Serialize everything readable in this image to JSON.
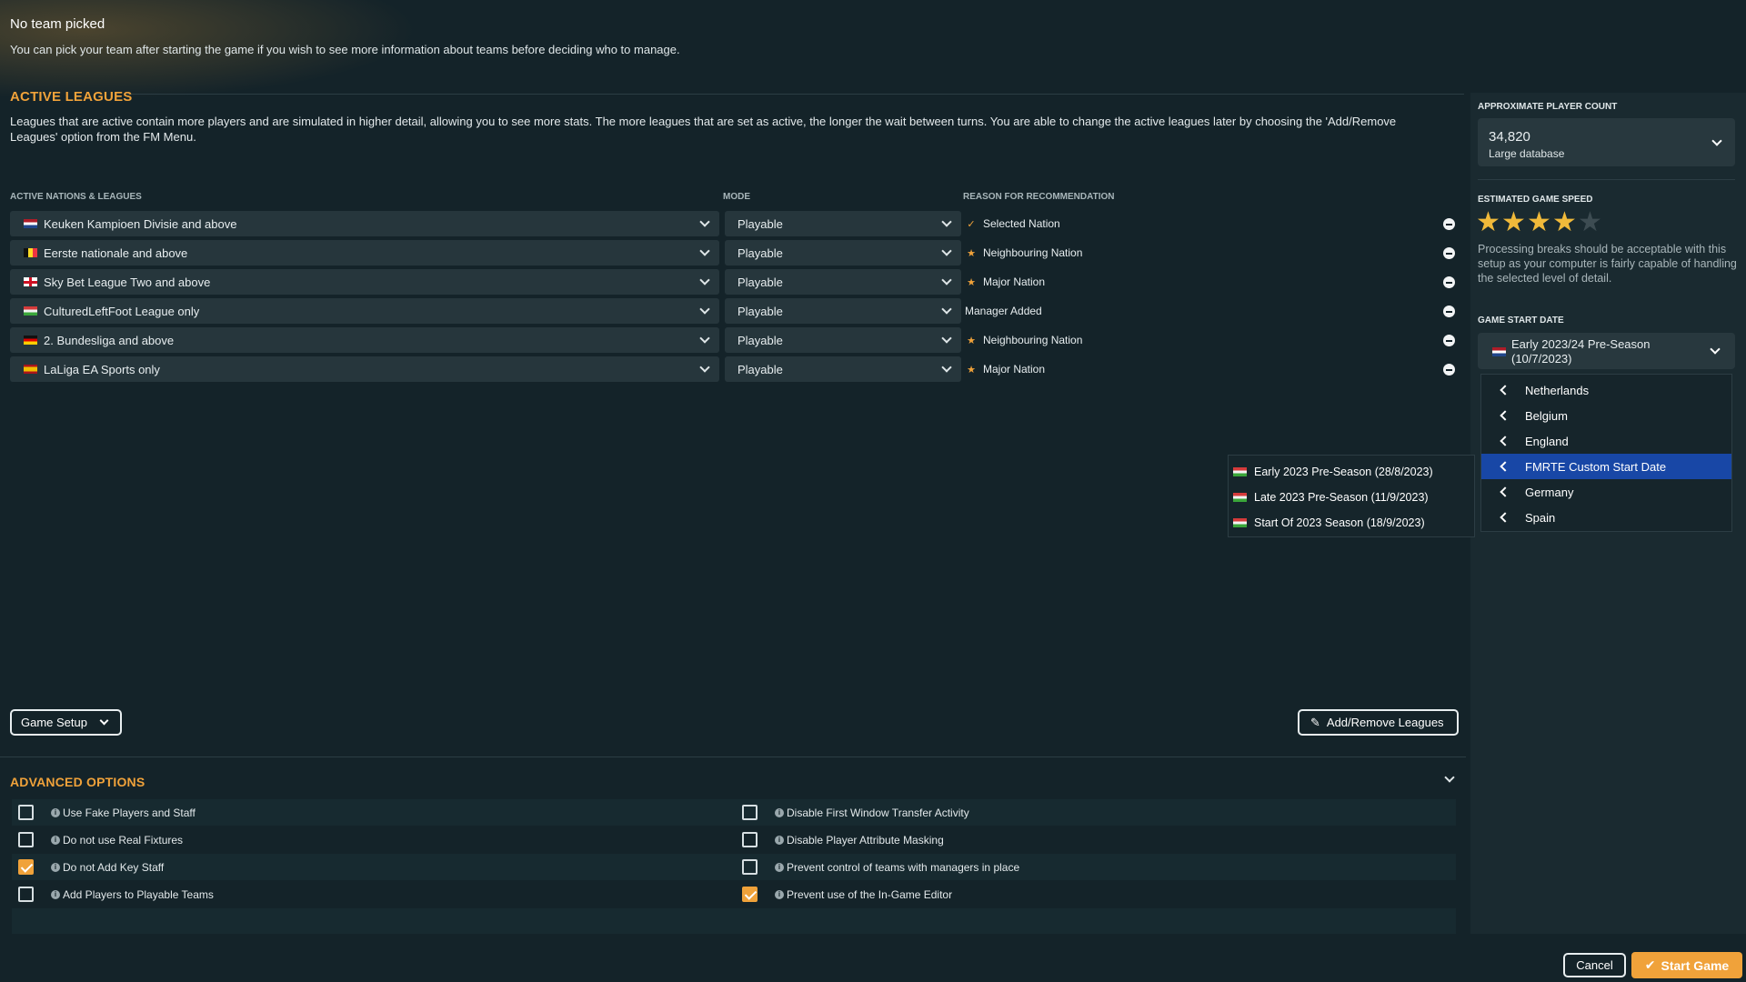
{
  "team": {
    "title": "No team picked",
    "subtitle": "You can pick your team after starting the game if you wish to see more information about teams before deciding who to manage."
  },
  "active_leagues": {
    "title": "ACTIVE LEAGUES",
    "description": "Leagues that are active contain more players and are simulated in higher detail, allowing you to see more stats. The more leagues that are set as active, the longer the wait between turns. You are able to change the active leagues later by choosing the 'Add/Remove Leagues' option from the FM Menu.",
    "col_nations": "ACTIVE NATIONS & LEAGUES",
    "col_mode": "MODE",
    "col_reason": "REASON FOR RECOMMENDATION",
    "rows": [
      {
        "flag": "netherlands",
        "league": "Keuken Kampioen Divisie and above",
        "mode": "Playable",
        "reason_icon": "check-icon",
        "reason": "Selected Nation"
      },
      {
        "flag": "belgium",
        "league": "Eerste nationale and above",
        "mode": "Playable",
        "reason_icon": "star-icon",
        "reason": "Neighbouring Nation"
      },
      {
        "flag": "england",
        "league": "Sky Bet League Two and above",
        "mode": "Playable",
        "reason_icon": "star-icon",
        "reason": "Major Nation"
      },
      {
        "flag": "custom",
        "league": "CulturedLeftFoot League only",
        "mode": "Playable",
        "reason_icon": "",
        "reason": "Manager Added"
      },
      {
        "flag": "germany",
        "league": "2. Bundesliga and above",
        "mode": "Playable",
        "reason_icon": "star-icon",
        "reason": "Neighbouring Nation"
      },
      {
        "flag": "spain",
        "league": "LaLiga EA Sports only",
        "mode": "Playable",
        "reason_icon": "star-icon",
        "reason": "Major Nation"
      }
    ]
  },
  "buttons": {
    "game_setup": "Game Setup",
    "add_remove": "Add/Remove Leagues",
    "cancel": "Cancel",
    "start": "Start Game"
  },
  "advanced": {
    "title": "ADVANCED OPTIONS",
    "left": [
      {
        "label": "Use Fake Players and Staff",
        "checked": false
      },
      {
        "label": "Do not use Real Fixtures",
        "checked": false
      },
      {
        "label": "Do not Add Key Staff",
        "checked": true
      },
      {
        "label": "Add Players to Playable Teams",
        "checked": false
      }
    ],
    "right": [
      {
        "label": "Disable First Window Transfer Activity",
        "checked": false
      },
      {
        "label": "Disable Player Attribute Masking",
        "checked": false
      },
      {
        "label": "Prevent control of teams with managers in place",
        "checked": false
      },
      {
        "label": "Prevent use of the In-Game Editor",
        "checked": true
      }
    ]
  },
  "side": {
    "player_count_label": "APPROXIMATE PLAYER COUNT",
    "player_count": "34,820",
    "database": "Large database",
    "speed_label": "ESTIMATED GAME SPEED",
    "speed_stars": 4,
    "speed_max": 5,
    "speed_text": "Processing breaks should be acceptable with this setup as your computer is fairly capable of handling the selected level of detail.",
    "start_date_label": "GAME START DATE",
    "start_date_line1": "Early 2023/24 Pre-Season",
    "start_date_line2": "(10/7/2023)"
  },
  "nation_menu": [
    "Netherlands",
    "Belgium",
    "England",
    "FMRTE Custom Start Date",
    "Germany",
    "Spain"
  ],
  "nation_menu_selected": 3,
  "submenu": [
    "Early 2023 Pre-Season (28/8/2023)",
    "Late 2023 Pre-Season (11/9/2023)",
    "Start Of 2023 Season (18/9/2023)"
  ],
  "colors": {
    "accent": "#f0a23a",
    "selected": "#1847a6",
    "background": "#142329"
  }
}
